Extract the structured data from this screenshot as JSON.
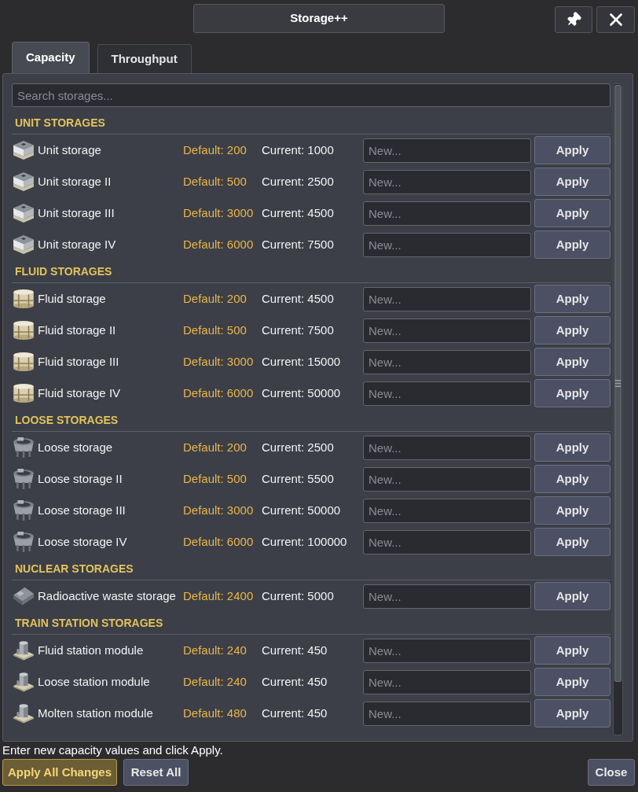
{
  "window": {
    "title": "Storage++"
  },
  "tabs": [
    {
      "label": "Capacity",
      "selected": true
    },
    {
      "label": "Throughput",
      "selected": false
    }
  ],
  "search": {
    "placeholder": "Search storages..."
  },
  "sections": [
    {
      "title": "UNIT STORAGES",
      "kind": "unit",
      "items": [
        {
          "name": "Unit storage",
          "default": "Default: 200",
          "current": "Current: 1000",
          "placeholder": "New...",
          "button": "Apply"
        },
        {
          "name": "Unit storage II",
          "default": "Default: 500",
          "current": "Current: 2500",
          "placeholder": "New...",
          "button": "Apply"
        },
        {
          "name": "Unit storage III",
          "default": "Default: 3000",
          "current": "Current: 4500",
          "placeholder": "New...",
          "button": "Apply"
        },
        {
          "name": "Unit storage IV",
          "default": "Default: 6000",
          "current": "Current: 7500",
          "placeholder": "New...",
          "button": "Apply"
        }
      ]
    },
    {
      "title": "FLUID STORAGES",
      "kind": "fluid",
      "items": [
        {
          "name": "Fluid storage",
          "default": "Default: 200",
          "current": "Current: 4500",
          "placeholder": "New...",
          "button": "Apply"
        },
        {
          "name": "Fluid storage II",
          "default": "Default: 500",
          "current": "Current: 7500",
          "placeholder": "New...",
          "button": "Apply"
        },
        {
          "name": "Fluid storage III",
          "default": "Default: 3000",
          "current": "Current: 15000",
          "placeholder": "New...",
          "button": "Apply"
        },
        {
          "name": "Fluid storage IV",
          "default": "Default: 6000",
          "current": "Current: 50000",
          "placeholder": "New...",
          "button": "Apply"
        }
      ]
    },
    {
      "title": "LOOSE STORAGES",
      "kind": "loose",
      "items": [
        {
          "name": "Loose storage",
          "default": "Default: 200",
          "current": "Current: 2500",
          "placeholder": "New...",
          "button": "Apply"
        },
        {
          "name": "Loose storage II",
          "default": "Default: 500",
          "current": "Current: 5500",
          "placeholder": "New...",
          "button": "Apply"
        },
        {
          "name": "Loose storage III",
          "default": "Default: 3000",
          "current": "Current: 50000",
          "placeholder": "New...",
          "button": "Apply"
        },
        {
          "name": "Loose storage IV",
          "default": "Default: 6000",
          "current": "Current: 100000",
          "placeholder": "New...",
          "button": "Apply"
        }
      ]
    },
    {
      "title": "NUCLEAR STORAGES",
      "kind": "nuclear",
      "items": [
        {
          "name": "Radioactive waste storage",
          "default": "Default: 2400",
          "current": "Current: 5000",
          "placeholder": "New...",
          "button": "Apply"
        }
      ]
    },
    {
      "title": "TRAIN STATION STORAGES",
      "kind": "station",
      "items": [
        {
          "name": "Fluid station module",
          "default": "Default: 240",
          "current": "Current: 450",
          "placeholder": "New...",
          "button": "Apply"
        },
        {
          "name": "Loose station module",
          "default": "Default: 240",
          "current": "Current: 450",
          "placeholder": "New...",
          "button": "Apply"
        },
        {
          "name": "Molten station module",
          "default": "Default: 480",
          "current": "Current: 450",
          "placeholder": "New...",
          "button": "Apply"
        }
      ]
    }
  ],
  "footer": {
    "hint": "Enter new capacity values and click Apply.",
    "buttons": [
      {
        "label": "Apply All Changes",
        "kind": "primary"
      },
      {
        "label": "Reset All",
        "kind": "secondary"
      }
    ],
    "close": {
      "label": "Close"
    }
  }
}
